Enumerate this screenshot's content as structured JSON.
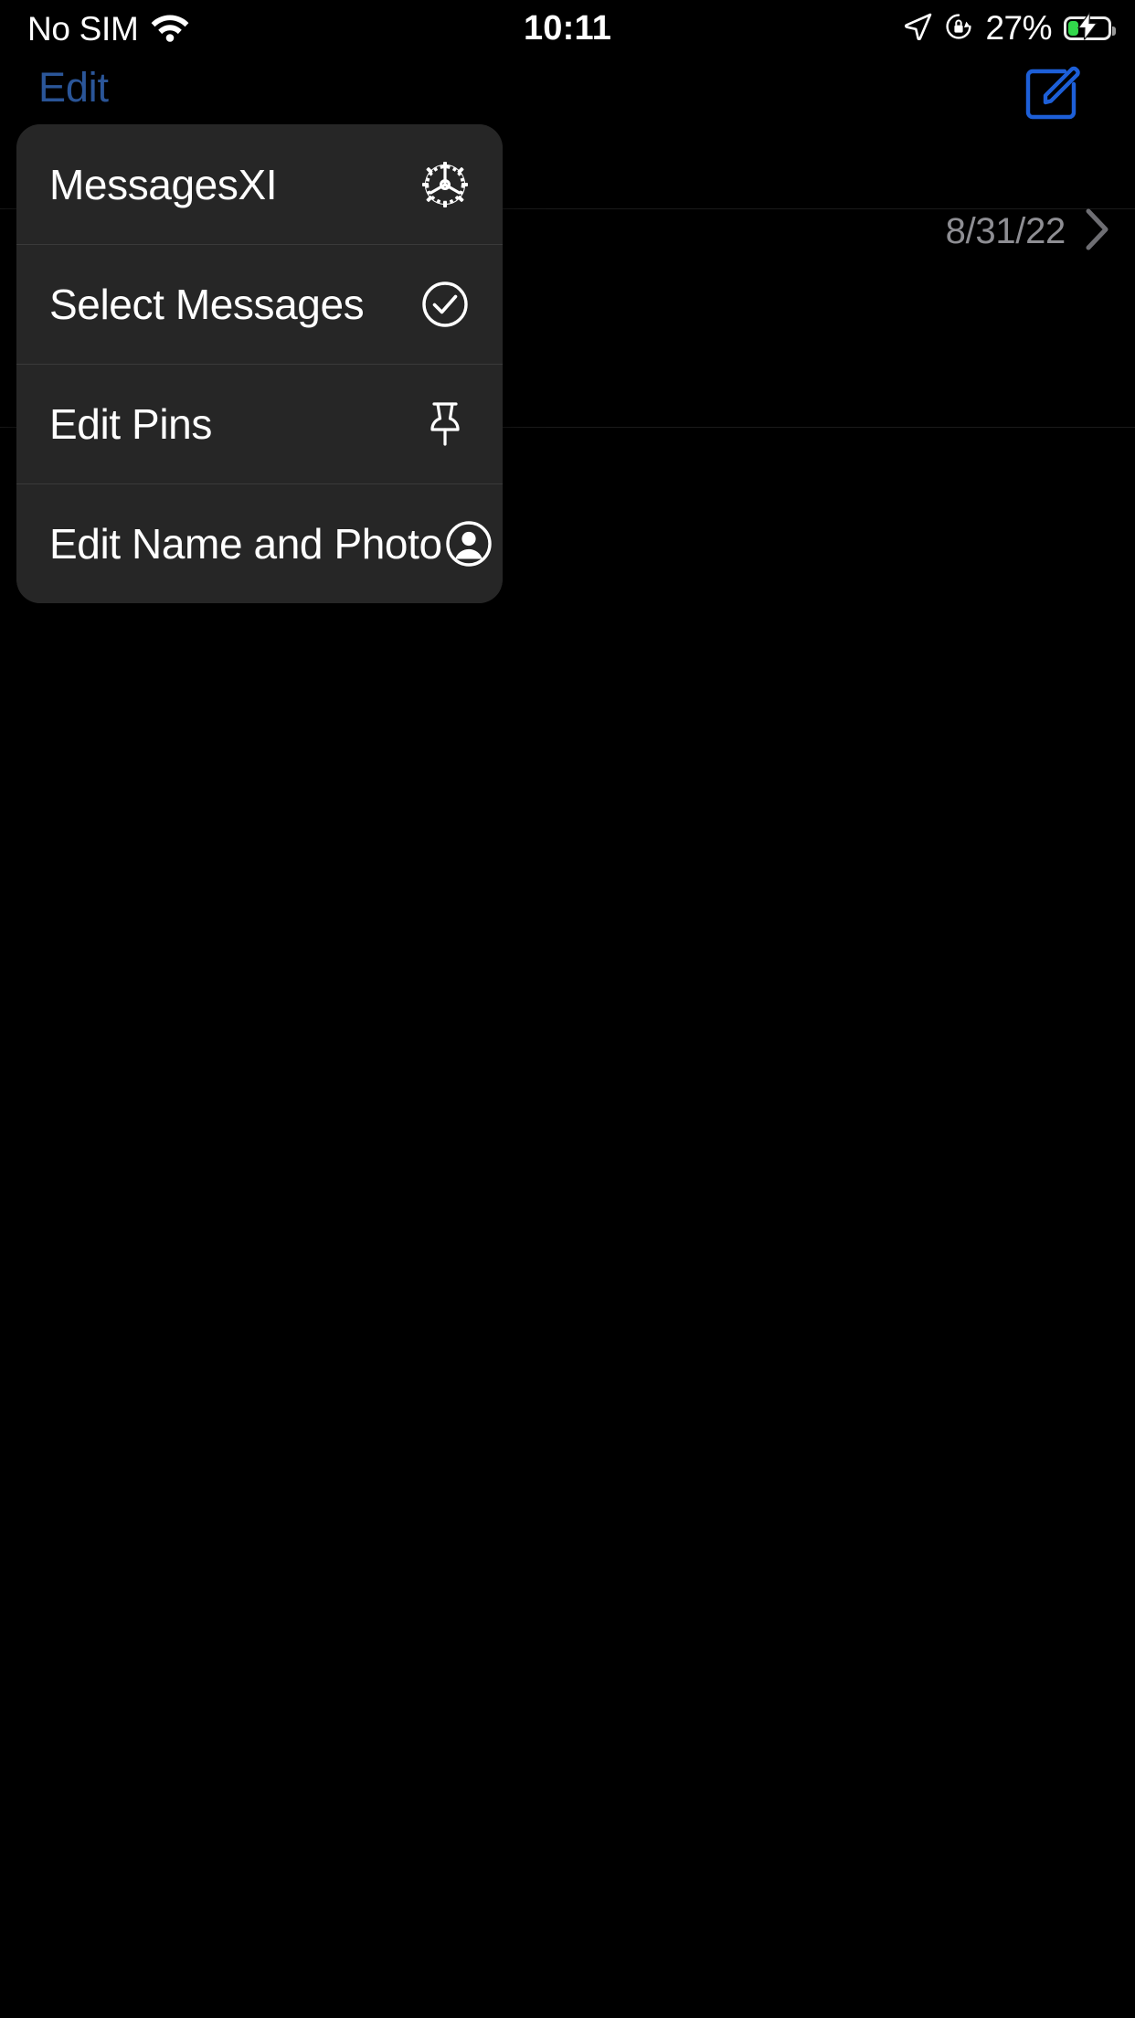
{
  "status_bar": {
    "carrier": "No SIM",
    "wifi_icon": "wifi-icon",
    "time": "10:11",
    "location_icon": "location-arrow-icon",
    "rotation_lock_icon": "rotation-lock-icon",
    "battery_percent": "27%",
    "battery_state": "charging",
    "battery_fill_color": "#32d74b"
  },
  "nav_bar": {
    "edit_label": "Edit",
    "edit_color": "#2b5699",
    "compose_icon": "compose-icon",
    "compose_color": "#1d5fd8"
  },
  "conversation": {
    "date": "8/31/22",
    "date_color": "#8e8e93",
    "chevron_icon": "chevron-right-icon"
  },
  "context_menu": {
    "background": "#262626",
    "separator": "#3a3a3a",
    "items": [
      {
        "label": "MessagesXI",
        "icon": "gear-icon"
      },
      {
        "label": "Select Messages",
        "icon": "checkmark-circle-icon"
      },
      {
        "label": "Edit Pins",
        "icon": "pin-icon"
      },
      {
        "label": "Edit Name and Photo",
        "icon": "person-circle-icon"
      }
    ]
  }
}
